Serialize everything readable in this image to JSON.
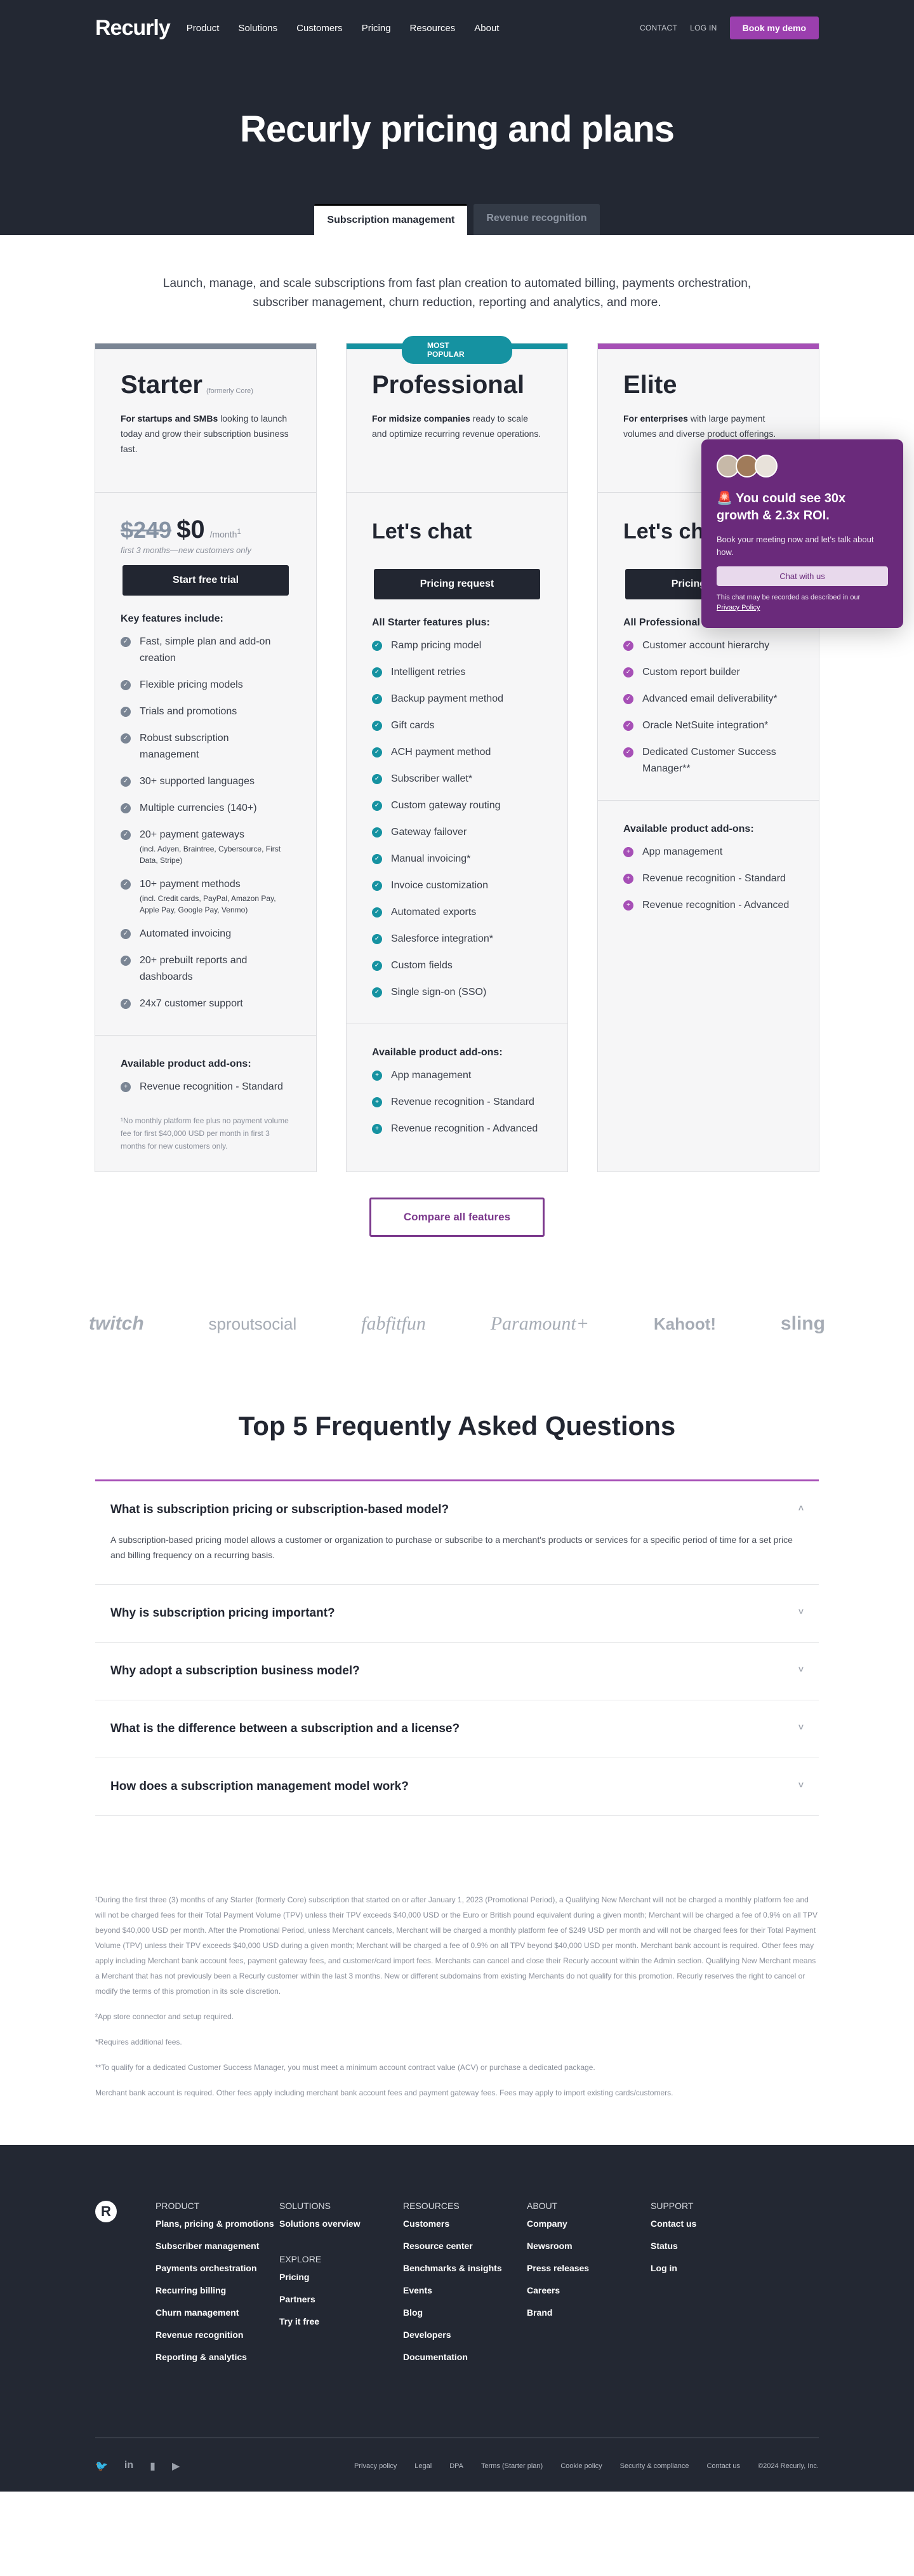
{
  "nav": {
    "logo": "Recurly",
    "links": [
      "Product",
      "Solutions",
      "Customers",
      "Pricing",
      "Resources",
      "About"
    ],
    "contact": "CONTACT",
    "login": "LOG IN",
    "demo": "Book my demo"
  },
  "hero": {
    "title": "Recurly pricing and plans",
    "tabs": [
      "Subscription management",
      "Revenue recognition"
    ]
  },
  "intro": "Launch, manage, and scale subscriptions from fast plan creation to automated billing, payments orchestration, subscriber management, churn reduction, reporting and analytics, and more.",
  "colors": {
    "starter": "#7a8594",
    "professional": "#1592a1",
    "elite": "#a64fb6",
    "brand_purple": "#9b3fae"
  },
  "plans": {
    "starter": {
      "name": "Starter",
      "formerly": "(formerly Core)",
      "desc_bold": "For startups and SMBs",
      "desc": " looking to launch today and grow their subscription business fast.",
      "old_price": "$249",
      "price": "$0",
      "per": "/month",
      "sup": "1",
      "price_note": "first 3 months—new customers only",
      "cta": "Start free trial",
      "features_title": "Key features include:",
      "features": [
        {
          "t": "Fast, simple plan and add-on creation",
          "s": ""
        },
        {
          "t": "Flexible pricing models",
          "s": ""
        },
        {
          "t": "Trials and promotions",
          "s": ""
        },
        {
          "t": "Robust subscription management",
          "s": ""
        },
        {
          "t": "30+ supported languages",
          "s": ""
        },
        {
          "t": "Multiple currencies (140+)",
          "s": ""
        },
        {
          "t": "20+ payment gateways",
          "s": "(incl. Adyen, Braintree, Cybersource, First Data, Stripe)"
        },
        {
          "t": "10+ payment methods",
          "s": "(incl. Credit cards, PayPal, Amazon Pay, Apple Pay, Google Pay, Venmo)"
        },
        {
          "t": "Automated invoicing",
          "s": ""
        },
        {
          "t": "20+ prebuilt reports and dashboards",
          "s": ""
        },
        {
          "t": "24x7 customer support",
          "s": ""
        }
      ],
      "addons_title": "Available product add-ons:",
      "addons": [
        "Revenue recognition - Standard"
      ],
      "note": "¹No monthly platform fee plus no payment volume fee for first $40,000 USD per month in first 3 months for new customers only."
    },
    "professional": {
      "badge": "MOST POPULAR",
      "name": "Professional",
      "desc_bold": "For midsize companies",
      "desc": " ready to scale and optimize recurring revenue operations.",
      "price": "Let's chat",
      "cta": "Pricing request",
      "features_title": "All Starter features plus:",
      "features": [
        "Ramp pricing model",
        "Intelligent retries",
        "Backup payment method",
        "Gift cards",
        "ACH payment method",
        "Subscriber wallet*",
        "Custom gateway routing",
        "Gateway failover",
        "Manual invoicing*",
        "Invoice customization",
        "Automated exports",
        "Salesforce integration*",
        "Custom fields",
        "Single sign-on (SSO)"
      ],
      "addons_title": "Available product add-ons:",
      "addons": [
        "App management",
        "Revenue recognition - Standard",
        "Revenue recognition - Advanced"
      ]
    },
    "elite": {
      "name": "Elite",
      "desc_bold": "For enterprises",
      "desc": " with large payment volumes and diverse product offerings.",
      "price": "Let's chat",
      "cta": "Pricing request",
      "features_title": "All Professional features plus:",
      "features": [
        "Customer account hierarchy",
        "Custom report builder",
        "Advanced email deliverability*",
        "Oracle NetSuite integration*",
        "Dedicated Customer Success Manager**"
      ],
      "addons_title": "Available product add-ons:",
      "addons": [
        "App management",
        "Revenue recognition - Standard",
        "Revenue recognition - Advanced"
      ]
    }
  },
  "compare": "Compare all features",
  "logos": [
    "twitch",
    "sproutsocial",
    "fabfitfun",
    "Paramount+",
    "Kahoot!",
    "sling"
  ],
  "faq": {
    "title": "Top 5 Frequently Asked Questions",
    "items": [
      {
        "q": "What is subscription pricing or subscription-based model?",
        "a": "A subscription-based pricing model allows a customer or organization to purchase or subscribe to a merchant's products or services for a specific period of time for a set price and billing frequency on a recurring basis.",
        "open": true
      },
      {
        "q": "Why is subscription pricing important?",
        "a": "",
        "open": false
      },
      {
        "q": "Why adopt a subscription business model?",
        "a": "",
        "open": false
      },
      {
        "q": "What is the difference between a subscription and a license?",
        "a": "",
        "open": false
      },
      {
        "q": "How does a subscription management model work?",
        "a": "",
        "open": false
      }
    ]
  },
  "fine_print": [
    "¹During the first three (3) months of any Starter (formerly Core) subscription that started on or after January 1, 2023 (Promotional Period), a Qualifying New Merchant will not be charged a monthly platform fee and will not be charged fees for their Total Payment Volume (TPV) unless their TPV exceeds $40,000 USD or the Euro or British pound equivalent during a given month; Merchant will be charged a fee of 0.9% on all TPV beyond $40,000 USD per month. After the Promotional Period, unless Merchant cancels, Merchant will be charged a monthly platform fee of $249 USD per month and will not be charged fees for their Total Payment Volume (TPV) unless their TPV exceeds $40,000 USD during a given month; Merchant will be charged a fee of 0.9% on all TPV beyond $40,000 USD per month. Merchant bank account is required. Other fees may apply including Merchant bank account fees, payment gateway fees, and customer/card import fees. Merchants can cancel and close their Recurly account within the Admin section. Qualifying New Merchant means a Merchant that has not previously been a Recurly customer within the last 3 months. New or different subdomains from existing Merchants do not qualify for this promotion. Recurly reserves the right to cancel or modify the terms of this promotion in its sole discretion.",
    "²App store connector and setup required.",
    "*Requires additional fees.",
    "**To qualify for a dedicated Customer Success Manager, you must meet a minimum account contract value (ACV) or purchase a dedicated package.",
    "Merchant bank account is required. Other fees apply including merchant bank account fees and payment gateway fees. Fees may apply to import existing cards/customers."
  ],
  "popup": {
    "title": "🚨 You could see 30x growth & 2.3x ROI.",
    "body": "Book your meeting now and let's talk about how.",
    "button": "Chat with us",
    "disclaimer": "This chat may be recorded as described in our",
    "link": "Privacy Policy"
  },
  "footer": {
    "logo": "R",
    "columns": [
      {
        "title": "PRODUCT",
        "links": [
          "Plans, pricing & promotions",
          "Subscriber management",
          "Payments orchestration",
          "Recurring billing",
          "Churn management",
          "Revenue recognition",
          "Reporting & analytics"
        ]
      },
      {
        "title": "SOLUTIONS",
        "links": [
          "Solutions overview"
        ],
        "title2": "EXPLORE",
        "links2": [
          "Pricing",
          "Partners",
          "Try it free"
        ]
      },
      {
        "title": "RESOURCES",
        "links": [
          "Customers",
          "Resource center",
          "Benchmarks & insights",
          "Events",
          "Blog",
          "Developers",
          "Documentation"
        ]
      },
      {
        "title": "ABOUT",
        "links": [
          "Company",
          "Newsroom",
          "Press releases",
          "Careers",
          "Brand"
        ]
      },
      {
        "title": "SUPPORT",
        "links": [
          "Contact us",
          "Status",
          "Log in"
        ]
      }
    ],
    "social": [
      "twitter-icon",
      "linkedin-icon",
      "chat-bubble-icon",
      "youtube-icon"
    ],
    "bottom_links": [
      "Privacy policy",
      "Legal",
      "DPA",
      "Terms (Starter plan)",
      "Cookie policy",
      "Security & compliance",
      "Contact us"
    ],
    "copyright": "©2024 Recurly, Inc."
  }
}
